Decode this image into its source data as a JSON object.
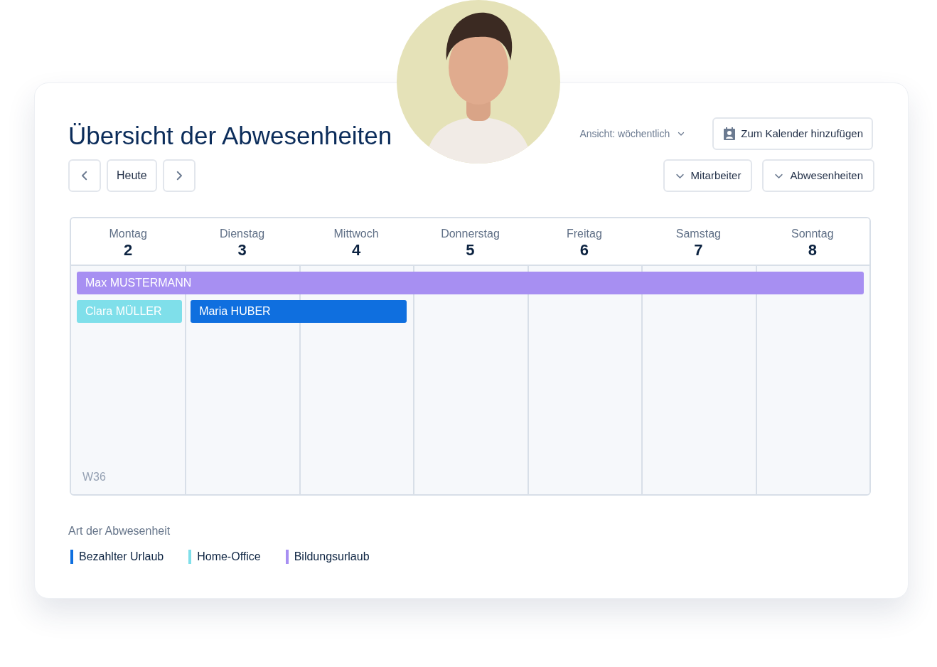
{
  "title": "Übersicht der Abwesenheiten",
  "view_selector": {
    "label": "Ansicht: wöchentlich"
  },
  "add_button": {
    "label": "Zum Kalender hinzufügen"
  },
  "nav": {
    "today": "Heute"
  },
  "filters": [
    {
      "label": "Mitarbeiter"
    },
    {
      "label": "Abwesenheiten"
    }
  ],
  "days": [
    {
      "name": "Montag",
      "date": "2"
    },
    {
      "name": "Dienstag",
      "date": "3"
    },
    {
      "name": "Mittwoch",
      "date": "4"
    },
    {
      "name": "Donnerstag",
      "date": "5"
    },
    {
      "name": "Freitag",
      "date": "6"
    },
    {
      "name": "Samstag",
      "date": "7"
    },
    {
      "name": "Sonntag",
      "date": "8"
    }
  ],
  "events": [
    {
      "name": "Max MUSTERMANN",
      "color": "#a78ff2",
      "days": [
        true,
        true,
        true,
        true,
        true,
        true,
        true
      ]
    },
    {
      "name": "Clara MÜLLER",
      "color": "#7fdfea",
      "days": [
        true,
        false,
        false,
        false,
        false,
        false,
        false
      ]
    },
    {
      "name": "Maria HUBER",
      "color": "#0f6fdf",
      "days": [
        false,
        true,
        true,
        false,
        false,
        false,
        false
      ]
    }
  ],
  "week_label": "W36",
  "legend": {
    "title": "Art der Abwesenheit",
    "items": [
      {
        "label": "Bezahlter Urlaub",
        "color": "#0f6fdf"
      },
      {
        "label": "Home-Office",
        "color": "#7fdfea"
      },
      {
        "label": "Bildungsurlaub",
        "color": "#a78ff2"
      }
    ]
  }
}
